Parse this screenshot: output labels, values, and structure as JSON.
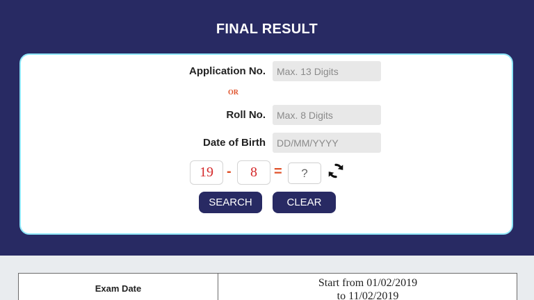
{
  "header": {
    "title": "FINAL RESULT"
  },
  "form": {
    "application_no": {
      "label": "Application No.",
      "placeholder": "Max. 13 Digits",
      "value": ""
    },
    "or_label": "OR",
    "roll_no": {
      "label": "Roll No.",
      "placeholder": "Max. 8 Digits",
      "value": ""
    },
    "dob": {
      "label": "Date of Birth",
      "placeholder": "DD/MM/YYYY",
      "value": ""
    },
    "captcha": {
      "operand_a": "19",
      "operator": "-",
      "operand_b": "8",
      "equals": "=",
      "answer_placeholder": "?",
      "refresh_icon": "refresh-icon"
    },
    "buttons": {
      "search": "SEARCH",
      "clear": "CLEAR"
    }
  },
  "schedule": {
    "header": "Exam Date",
    "value_line1": "Start from 01/02/2019",
    "value_line2": "to 11/02/2019"
  },
  "colors": {
    "banner": "#282a63",
    "card_border": "#8ee6f8",
    "captcha_digits": "#d4282a",
    "operator": "#e0522a"
  }
}
